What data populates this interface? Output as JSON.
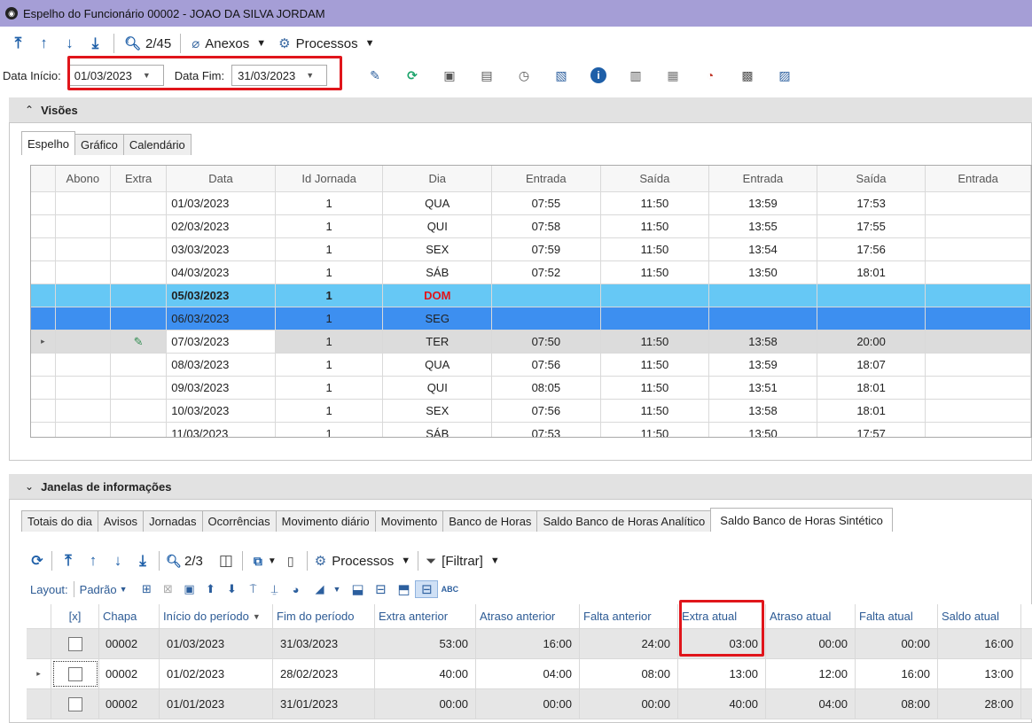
{
  "window": {
    "title": "Espelho do Funcionário 00002 - JOAO DA SILVA JORDAM"
  },
  "toolbar": {
    "counter": "2/45",
    "anexos": "Anexos",
    "processos": "Processos"
  },
  "dates": {
    "inicio_label": "Data Início:",
    "inicio_value": "01/03/2023",
    "fim_label": "Data Fim:",
    "fim_value": "31/03/2023"
  },
  "visoes": {
    "title": "Visões",
    "tabs": [
      "Espelho",
      "Gráfico",
      "Calendário"
    ]
  },
  "grid1": {
    "headers": [
      "Abono",
      "Extra",
      "Data",
      "Id Jornada",
      "Dia",
      "Entrada",
      "Saída",
      "Entrada",
      "Saída",
      "Entrada"
    ],
    "rows": [
      {
        "data": "01/03/2023",
        "id": "1",
        "dia": "QUA",
        "e1": "07:55",
        "s1": "11:50",
        "e2": "13:59",
        "s2": "17:53"
      },
      {
        "data": "02/03/2023",
        "id": "1",
        "dia": "QUI",
        "e1": "07:58",
        "s1": "11:50",
        "e2": "13:55",
        "s2": "17:55"
      },
      {
        "data": "03/03/2023",
        "id": "1",
        "dia": "SEX",
        "e1": "07:59",
        "s1": "11:50",
        "e2": "13:54",
        "s2": "17:56"
      },
      {
        "data": "04/03/2023",
        "id": "1",
        "dia": "SÁB",
        "e1": "07:52",
        "s1": "11:50",
        "e2": "13:50",
        "s2": "18:01"
      },
      {
        "data": "05/03/2023",
        "id": "1",
        "dia": "DOM",
        "e1": "",
        "s1": "",
        "e2": "",
        "s2": ""
      },
      {
        "data": "06/03/2023",
        "id": "1",
        "dia": "SEG",
        "e1": "",
        "s1": "",
        "e2": "",
        "s2": ""
      },
      {
        "data": "07/03/2023",
        "id": "1",
        "dia": "TER",
        "e1": "07:50",
        "s1": "11:50",
        "e2": "13:58",
        "s2": "20:00"
      },
      {
        "data": "08/03/2023",
        "id": "1",
        "dia": "QUA",
        "e1": "07:56",
        "s1": "11:50",
        "e2": "13:59",
        "s2": "18:07"
      },
      {
        "data": "09/03/2023",
        "id": "1",
        "dia": "QUI",
        "e1": "08:05",
        "s1": "11:50",
        "e2": "13:51",
        "s2": "18:01"
      },
      {
        "data": "10/03/2023",
        "id": "1",
        "dia": "SEX",
        "e1": "07:56",
        "s1": "11:50",
        "e2": "13:58",
        "s2": "18:01"
      },
      {
        "data": "11/03/2023",
        "id": "1",
        "dia": "SÁB",
        "e1": "07:53",
        "s1": "11:50",
        "e2": "13:50",
        "s2": "17:57"
      }
    ]
  },
  "janelas": {
    "title": "Janelas de informações",
    "tabs": [
      "Totais do dia",
      "Avisos",
      "Jornadas",
      "Ocorrências",
      "Movimento diário",
      "Movimento",
      "Banco de Horas",
      "Saldo Banco de Horas Analítico",
      "Saldo Banco de Horas Sintético"
    ]
  },
  "tool3": {
    "counter": "2/3",
    "processos": "Processos",
    "filtrar": "[Filtrar]"
  },
  "tool4": {
    "layout": "Layout:",
    "padrao": "Padrão"
  },
  "grid2": {
    "headers": [
      "[x]",
      "Chapa",
      "Início do período",
      "Fim do período",
      "Extra anterior",
      "Atraso anterior",
      "Falta anterior",
      "Extra atual",
      "Atraso atual",
      "Falta atual",
      "Saldo atual"
    ],
    "rows": [
      [
        "00002",
        "01/03/2023",
        "31/03/2023",
        "53:00",
        "16:00",
        "24:00",
        "03:00",
        "00:00",
        "00:00",
        "16:00"
      ],
      [
        "00002",
        "01/02/2023",
        "28/02/2023",
        "40:00",
        "04:00",
        "08:00",
        "13:00",
        "12:00",
        "16:00",
        "13:00"
      ],
      [
        "00002",
        "01/01/2023",
        "31/01/2023",
        "00:00",
        "00:00",
        "00:00",
        "40:00",
        "04:00",
        "08:00",
        "28:00"
      ]
    ]
  }
}
